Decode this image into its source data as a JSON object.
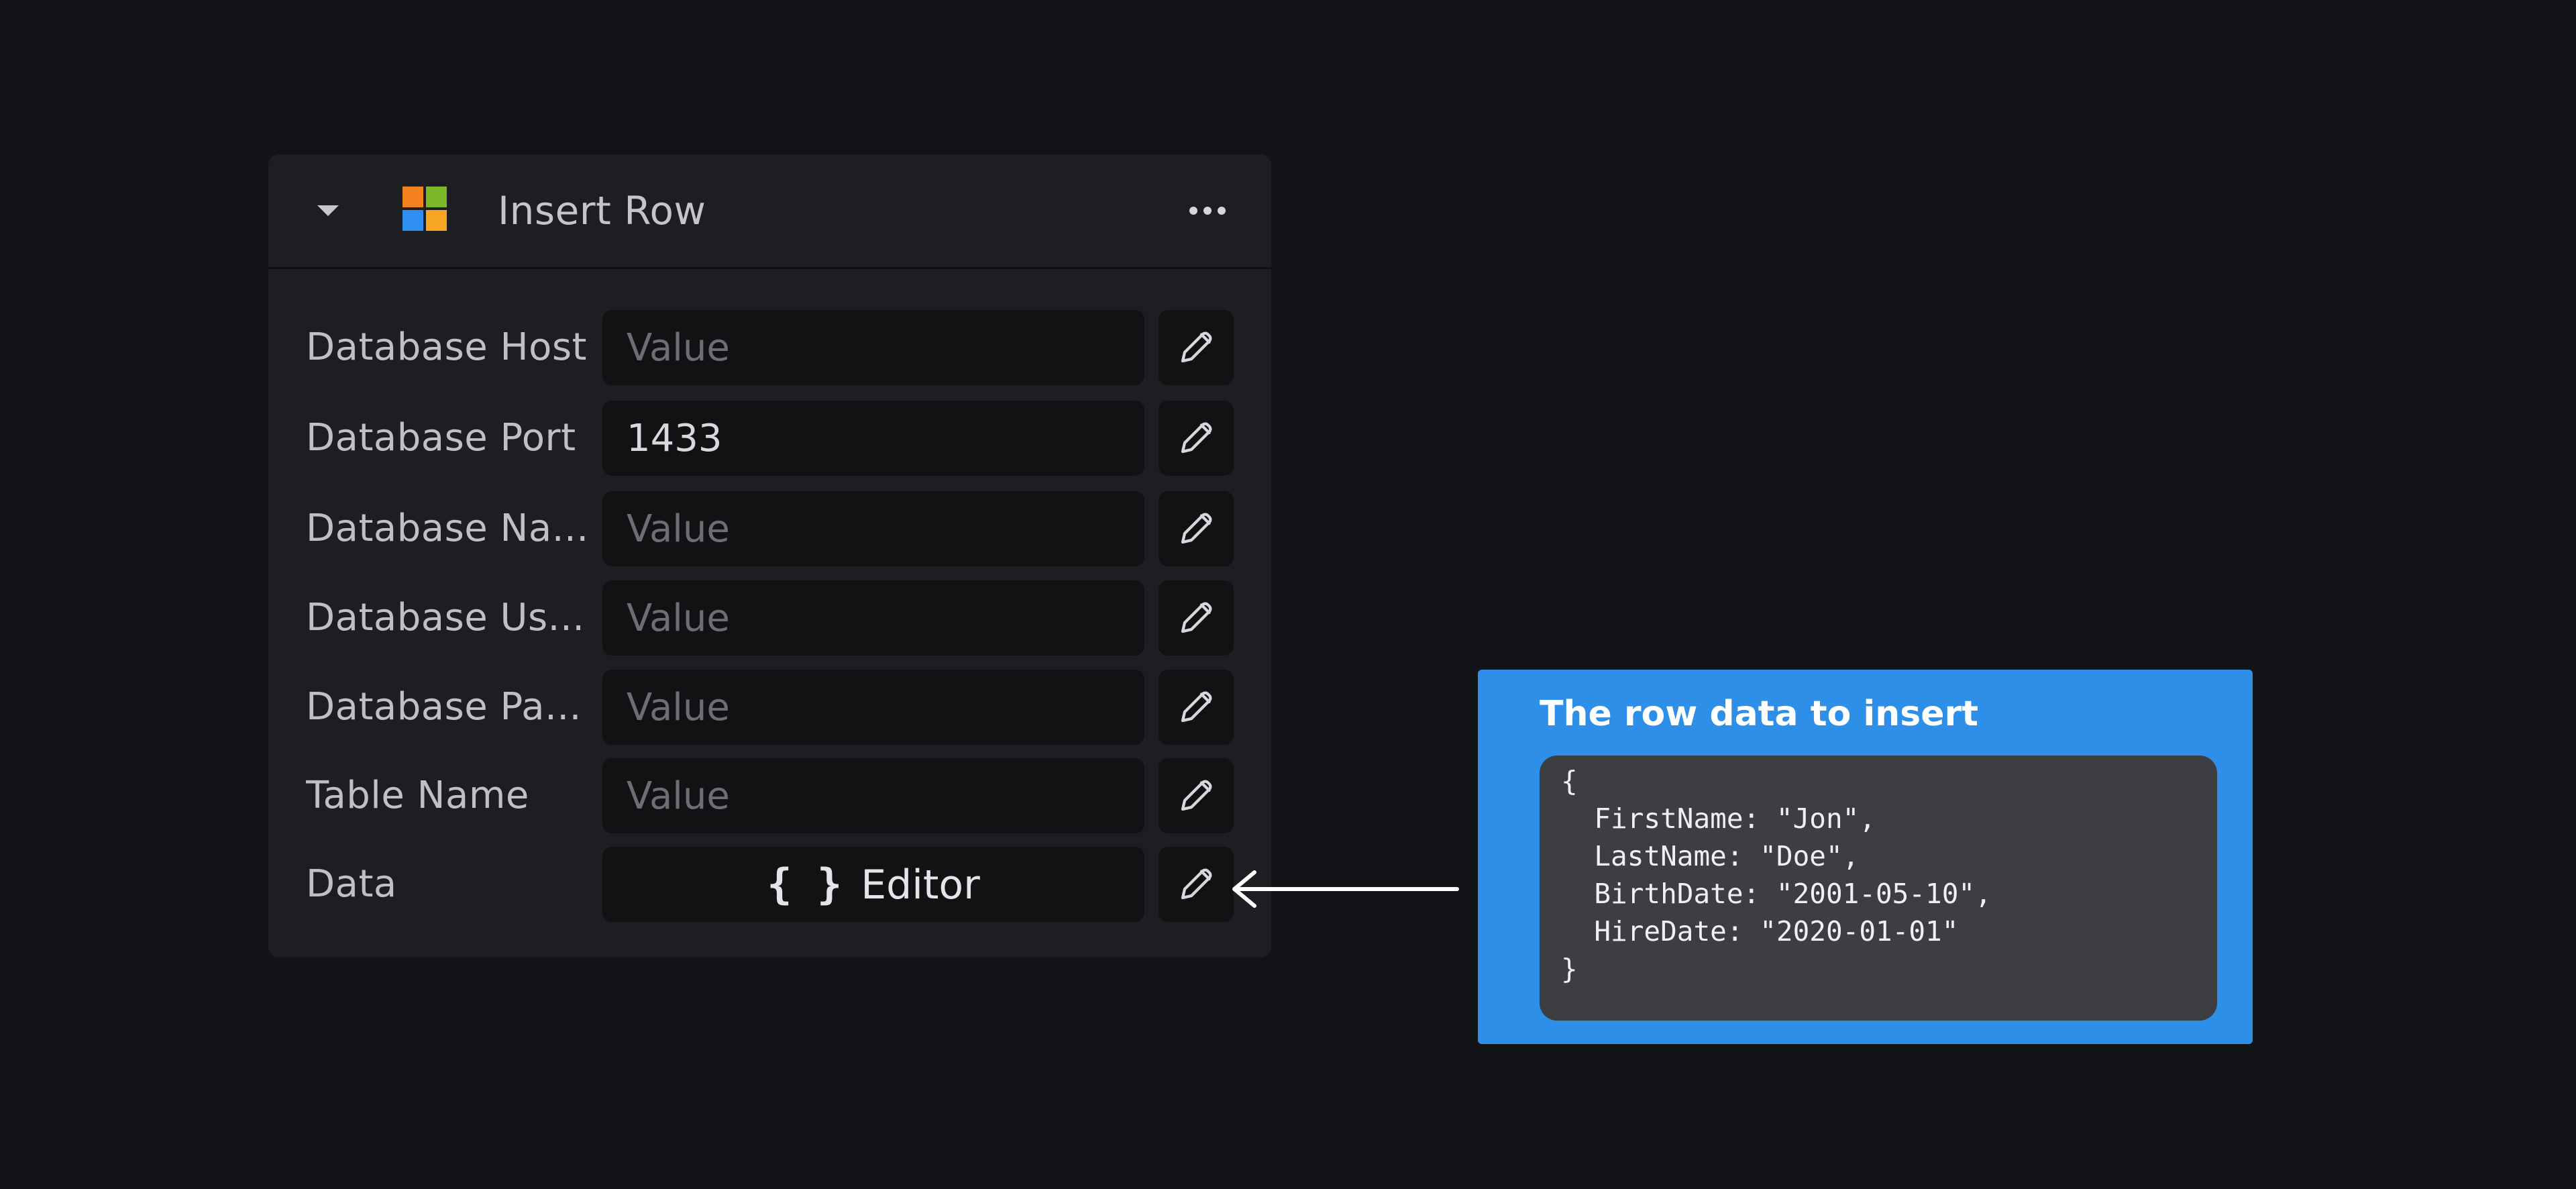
{
  "node": {
    "title": "Insert Row",
    "icon": "microsoft-sql-logo",
    "fields": [
      {
        "label": "Database Host",
        "value": "",
        "placeholder": "Value"
      },
      {
        "label": "Database Port",
        "value": "1433",
        "placeholder": "Value"
      },
      {
        "label": "Database Na...",
        "value": "",
        "placeholder": "Value"
      },
      {
        "label": "Database Us...",
        "value": "",
        "placeholder": "Value"
      },
      {
        "label": "Database Pa...",
        "value": "",
        "placeholder": "Value"
      },
      {
        "label": "Table Name",
        "value": "",
        "placeholder": "Value"
      }
    ],
    "data_field": {
      "label": "Data",
      "button_braces": "{ }",
      "button_label": "Editor"
    }
  },
  "tooltip": {
    "title": "The row data to insert",
    "code_lines": [
      "{",
      "  FirstName: \"Jon\",",
      "  LastName: \"Doe\",",
      "  BirthDate: \"2001-05-10\",",
      "  HireDate: \"2020-01-01\"",
      "}"
    ]
  },
  "colors": {
    "background": "#131417",
    "card": "#1d1e22",
    "input": "#111214",
    "tooltip": "#2d8fe8",
    "code_box": "#3d3e42"
  }
}
